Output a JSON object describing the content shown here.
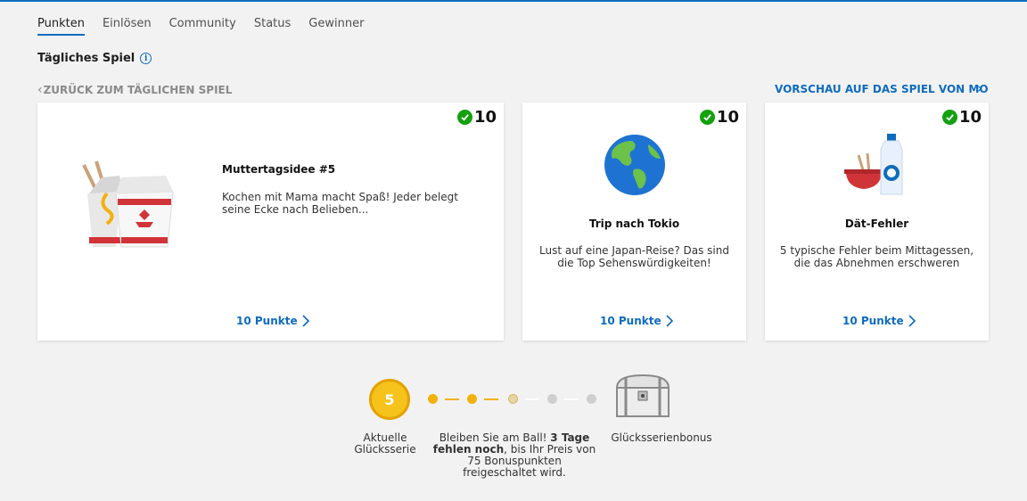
{
  "tabs": [
    {
      "label": "Punkten",
      "active": true
    },
    {
      "label": "Einlösen",
      "active": false
    },
    {
      "label": "Community",
      "active": false
    },
    {
      "label": "Status",
      "active": false
    },
    {
      "label": "Gewinner",
      "active": false
    }
  ],
  "section": {
    "title": "Tägliches Spiel",
    "info_icon": "i"
  },
  "nav": {
    "back_label": "ZURÜCK ZUM TÄGLICHEN SPIEL",
    "preview_label": "VORSCHAU AUF DAS SPIEL VON MORGEN"
  },
  "cards": [
    {
      "points_badge": "10",
      "completed": true,
      "title": "Muttertagsidee #5",
      "description": "Kochen mit Mama macht Spaß! Jeder belegt seine Ecke nach Belieben...",
      "points_link": "10 Punkte",
      "icon": "takeout-box-icon"
    },
    {
      "points_badge": "10",
      "completed": true,
      "title": "Trip nach Tokio",
      "description": "Lust auf eine Japan-Reise? Das sind die Top Sehenswürdigkeiten!",
      "points_link": "10 Punkte",
      "icon": "globe-icon"
    },
    {
      "points_badge": "10",
      "completed": true,
      "title": "Dät-Fehler",
      "description": "5 typische Fehler beim Mittagessen, die das Abnehmen erschweren",
      "points_link": "10 Punkte",
      "icon": "bowl-bottle-icon"
    }
  ],
  "streak": {
    "count": "5",
    "current_label": "Aktuelle Glücksserie",
    "message_prefix": "Bleiben Sie am Ball! ",
    "message_bold": "3 Tage fehlen noch",
    "message_suffix": ", bis Ihr Preis von 75 Bonuspunkten freigeschaltet wird.",
    "bonus_label": "Glücksserienbonus",
    "days_completed": 2,
    "days_total": 5,
    "colors": {
      "filled": "#f2b10d",
      "partial": "#e8d4a0",
      "empty": "#cfcfcf",
      "coin": "#f6c21c"
    }
  },
  "colors": {
    "accent": "#0f6cbd",
    "check": "#13a10e"
  }
}
